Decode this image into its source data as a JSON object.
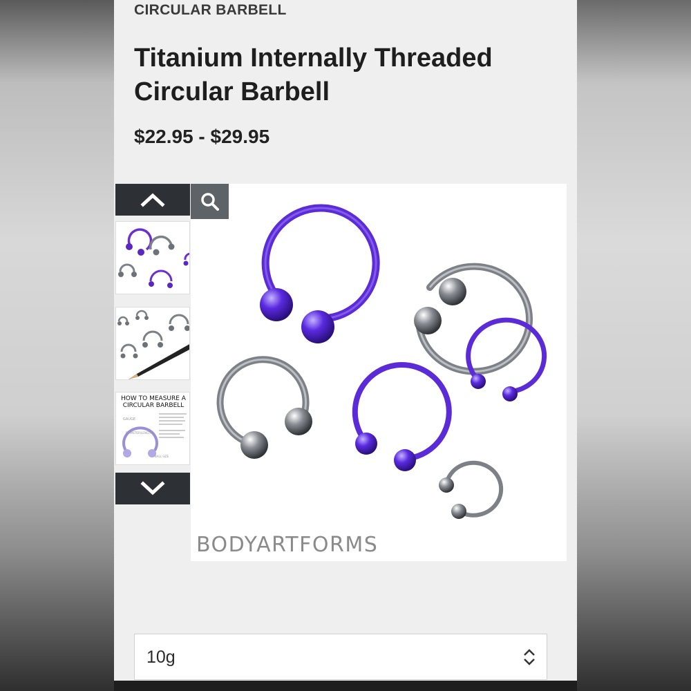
{
  "product": {
    "category": "CIRCULAR BARBELL",
    "title": "Titanium Internally Threaded Circular Barbell",
    "price_range": "$22.95 - $29.95"
  },
  "gallery": {
    "nav_up_icon": "chevron-up-icon",
    "nav_down_icon": "chevron-down-icon",
    "zoom_icon": "magnifier-icon",
    "brand_watermark": "BODYARTFORMS",
    "thumbnails": [
      {
        "name": "thumbnail-jewelry-group"
      },
      {
        "name": "thumbnail-jewelry-with-pencil"
      },
      {
        "name": "thumbnail-measure-guide",
        "heading": "HOW TO MEASURE A CIRCULAR BARBELL",
        "labels": [
          "GAUGE",
          "DIAMETER/LENGTH",
          "BALL SIZE"
        ]
      }
    ]
  },
  "options": {
    "gauge_select": {
      "value": "10g"
    }
  },
  "colors": {
    "purple": "#6a2fd0",
    "steel": "#8c9097",
    "nav_dark": "#2d3034",
    "zoom_bg": "#5e6368"
  }
}
